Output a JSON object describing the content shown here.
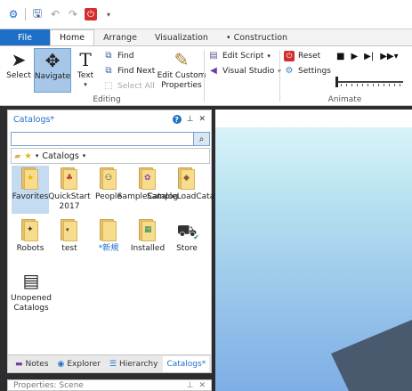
{
  "quick_access": {
    "app_icon": "gear-app-icon",
    "save_icon": "save-icon",
    "undo_icon": "undo-icon",
    "redo_icon": "redo-icon",
    "power_icon": "power-icon"
  },
  "tabs": [
    {
      "label": "File"
    },
    {
      "label": "Home"
    },
    {
      "label": "Arrange"
    },
    {
      "label": "Visualization"
    },
    {
      "label": "• Construction"
    }
  ],
  "ribbon": {
    "select_label": "Select",
    "navigate_label": "Navigate",
    "text_label": "Text",
    "find_label": "Find",
    "find_next_label": "Find Next",
    "select_all_label": "Select All",
    "edit_custom_label": "Edit Custom Properties",
    "editing_group": "Editing",
    "edit_script_label": "Edit Script",
    "visual_studio_label": "Visual Studio",
    "reset_label": "Reset",
    "settings_label": "Settings",
    "animate_group": "Animate"
  },
  "catalogs_panel": {
    "title": "Catalogs*",
    "search_value": "",
    "breadcrumb": "Catalogs",
    "items": [
      {
        "label": "Favorites"
      },
      {
        "label": "QuickStart 2017"
      },
      {
        "label": "People"
      },
      {
        "label": "SampleCatalog"
      },
      {
        "label": "SampleLoadCatalog"
      },
      {
        "label": "Robots"
      },
      {
        "label": "test"
      },
      {
        "label": "*新規"
      },
      {
        "label": "Installed"
      },
      {
        "label": "Store"
      },
      {
        "label": "Unopened Catalogs"
      }
    ],
    "bottom_tabs": [
      {
        "label": "Notes"
      },
      {
        "label": "Explorer"
      },
      {
        "label": "Hierarchy"
      },
      {
        "label": "Catalogs*"
      }
    ]
  },
  "properties_panel": {
    "title": "Properties: Scene"
  },
  "colors": {
    "accent": "#1e6fc7",
    "selected": "#a7c7e8",
    "viewport_top": "#e2f8fb",
    "viewport_bottom": "#7eaee6",
    "floor": "#4a5a6e"
  }
}
